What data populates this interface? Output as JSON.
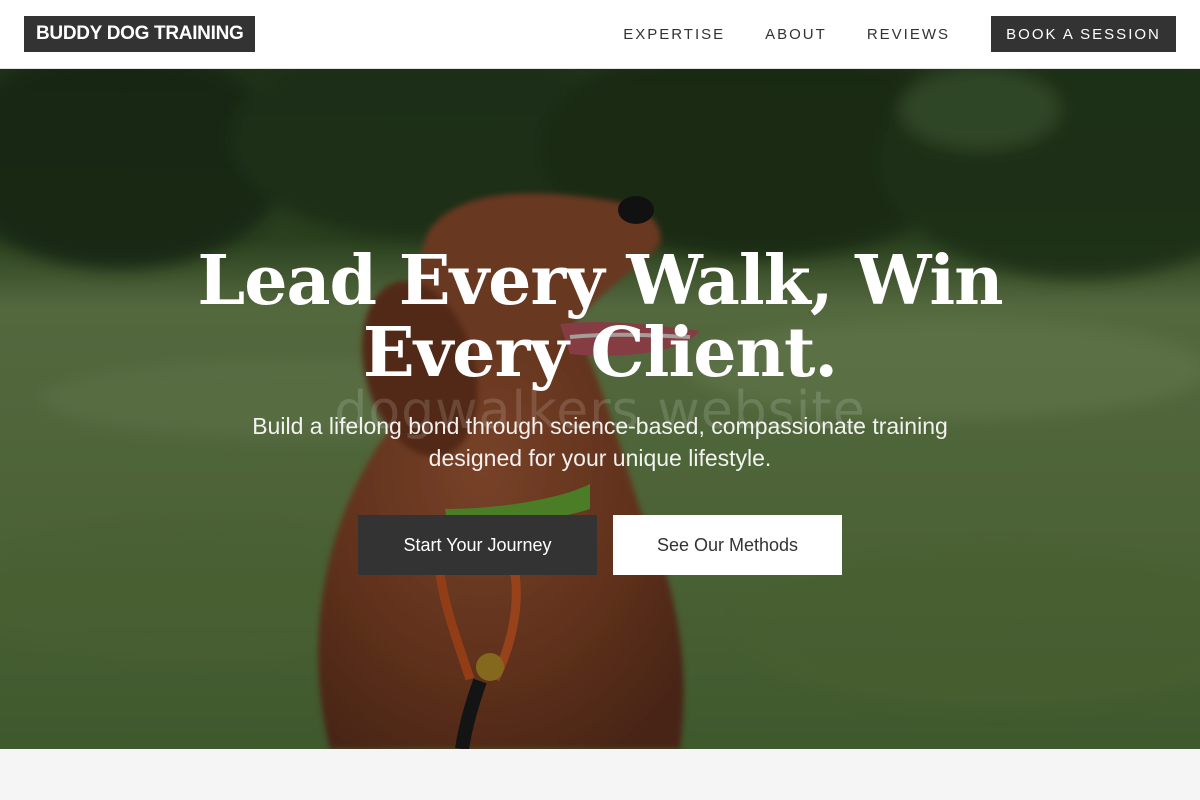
{
  "header": {
    "logo": "BUDDY DOG TRAINING",
    "nav": [
      "EXPERTISE",
      "ABOUT",
      "REVIEWS"
    ],
    "cta": "BOOK A SESSION"
  },
  "hero": {
    "title_line1": "Lead Every Walk, Win",
    "title_line2": "Every Client.",
    "watermark": "dogwalkers website",
    "subtitle_line1": "Build a lifelong bond through science-based, compassionate training",
    "subtitle_line2": "designed for your unique lifestyle.",
    "primary_button": "Start Your Journey",
    "secondary_button": "See Our Methods",
    "image": "hero-dog-photo"
  },
  "colors": {
    "brand_dark": "#333333",
    "background": "#f5f5f5",
    "white": "#ffffff"
  }
}
